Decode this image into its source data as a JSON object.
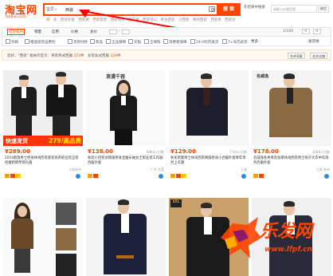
{
  "logo": {
    "main": "淘宝网",
    "sub": "Taobao.com"
  },
  "search": {
    "type_label": "宝贝",
    "value": "西装",
    "button": "搜 索",
    "cart_label": "在结果中搜索",
    "sub_placeholder": "请输入价格范围",
    "sub_button": "确定"
  },
  "hot_links": [
    "男",
    "女",
    "西装外套",
    "西装裙",
    "西装套装",
    "西装领带",
    "西装裤",
    "西装领口",
    "修身西装",
    "小西装",
    "休闲西装",
    "西装男",
    "西装女"
  ],
  "sortbar": {
    "items": [
      "综合排序",
      "销量",
      "信用",
      "价格",
      "总价"
    ],
    "price_sep": "-",
    "right": [
      "1/100",
      "<",
      ">"
    ]
  },
  "filters": [
    "包邮",
    "赠送退货运费险",
    "货到付款",
    "新品",
    "正品保障",
    "天猫",
    "全球购",
    "消费者保障",
    "24小时内发货",
    "7+天内退货",
    "更多"
  ],
  "filters_right": "发货地",
  "notice": {
    "prefix": "您好，\"西装\" 相关的宝贝：",
    "part1_label": "男装男式西服 ",
    "part1_count": "374",
    "part1_unit": "件",
    "part2_label": "女装女式西服 ",
    "part2_count": "329",
    "part2_unit": "件",
    "btn_list": "合并同款",
    "btn_shop": "合并店铺"
  },
  "products": [
    {
      "price": "¥289.00",
      "sales": "",
      "title": "2016新款男士修身休闲西装套装商务职业装正装结婚新郎伴郎礼服",
      "shop": "江苏苏州",
      "location": "",
      "promo_left": "快速发货",
      "promo_right": "279/高品质"
    },
    {
      "price": "¥138.00",
      "sales": "6864人付款",
      "title": "秋装小西装女韩版修身显瘦长袖女士职业装工作服西服外套",
      "shop": "广东 东莞",
      "location": "",
      "brand": "浪漫千容"
    },
    {
      "price": "¥129.00",
      "sales": "7744人付款",
      "title": "秋冬新款男士休闲西装韩版修身小西服外套青年单西上衣潮",
      "shop": "上海",
      "location": ""
    },
    {
      "price": "¥178.00",
      "sales": "1008人付款",
      "title": "名威逸冬季男装加厚休闲西装男士呢子大衣中年商务西服外套",
      "shop": "江苏 苏州",
      "location": "",
      "brand": "名威逸"
    }
  ],
  "watermark": {
    "text": "乐发网",
    "url": "www.lfpf.cn"
  },
  "colors": {
    "accent": "#ff4400",
    "brand_blue": "#2b8ee5"
  }
}
